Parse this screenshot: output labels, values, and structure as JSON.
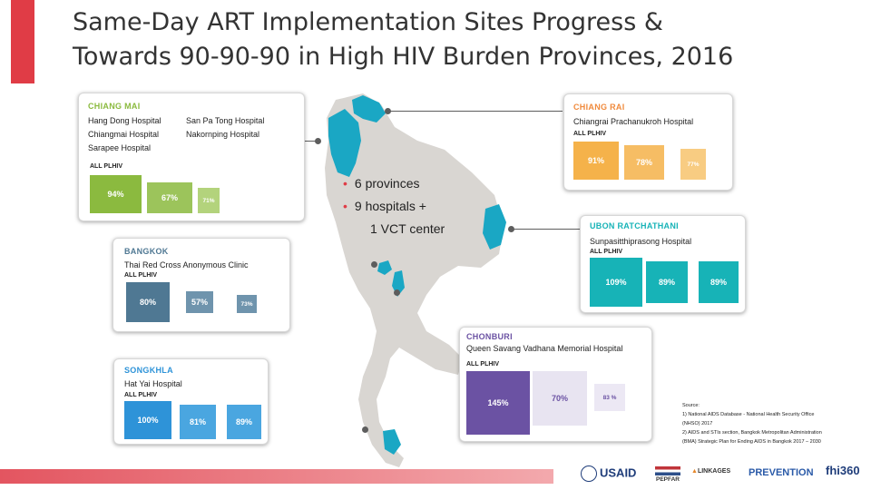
{
  "title": {
    "line1": "Same-Day ART Implementation Sites Progress &",
    "line2": "Towards 90-90-90 in High HIV Burden Provinces, 2016"
  },
  "summary": {
    "provinces": "6 provinces",
    "hospitals": "9 hospitals +",
    "vct": "1 VCT center"
  },
  "colors": {
    "chiang_mai": "#8bba3f",
    "chiang_rai": "#f5b24a",
    "bangkok": "#4f7893",
    "songkhla": "#2e93d8",
    "ubon": "#17b3b7",
    "chonburi": "#6b52a3",
    "map_highlight": "#1aa7c4",
    "accent": "#e03c46"
  },
  "cards": {
    "chiang_mai": {
      "province": "CHIANG MAI",
      "hospitals": [
        "Hang Dong Hospital",
        "San Pa Tong Hospital",
        "Chiangmai Hospital",
        "Nakornping Hospital",
        "Sarapee Hospital"
      ],
      "all_plhiv": "ALL PLHIV",
      "values": [
        "94%",
        "67%",
        "71%"
      ],
      "levels": [
        94,
        67,
        71
      ]
    },
    "chiang_rai": {
      "province": "CHIANG RAI",
      "hospital": "Chiangrai Prachanukroh Hospital",
      "all_plhiv": "ALL PLHIV",
      "values": [
        "91%",
        "78%",
        "77%"
      ],
      "levels": [
        91,
        78,
        77
      ]
    },
    "bangkok": {
      "province": "BANGKOK",
      "hospital": "Thai Red Cross Anonymous Clinic",
      "all_plhiv": "ALL PLHIV",
      "values": [
        "80%",
        "57%",
        "73%"
      ],
      "levels": [
        80,
        57,
        73
      ]
    },
    "ubon": {
      "province": "UBON RATCHATHANI",
      "hospital": "Sunpasitthiprasong Hospital",
      "all_plhiv": "ALL PLHIV",
      "values": [
        "109%",
        "89%",
        "89%"
      ],
      "levels": [
        109,
        89,
        89
      ]
    },
    "chonburi": {
      "province": "CHONBURI",
      "hospital": "Queen Savang Vadhana Memorial Hospital",
      "all_plhiv": "ALL PLHIV",
      "values": [
        "145%",
        "70%",
        "83 %"
      ],
      "levels": [
        145,
        70,
        83
      ]
    },
    "songkhla": {
      "province": "SONGKHLA",
      "hospital": "Hat Yai Hospital",
      "all_plhiv": "ALL PLHIV",
      "values": [
        "100%",
        "81%",
        "89%"
      ],
      "levels": [
        100,
        81,
        89
      ]
    }
  },
  "source": {
    "heading": "Source:",
    "line1": "1) National AIDS Database - National Health Security Office",
    "line2": "(NHSO) 2017",
    "line3": "2) AIDS and STIs section, Bangkok Metropolitan Administration",
    "line4": "(BMA) Strategic Plan for Ending AIDS in Bangkok 2017 – 2030"
  },
  "logos": {
    "usaid": "USAID",
    "pepfar": "PEPFAR",
    "linkages": "LINKAGES",
    "prevention": "PREVENTION",
    "fhi": "fhi360"
  }
}
